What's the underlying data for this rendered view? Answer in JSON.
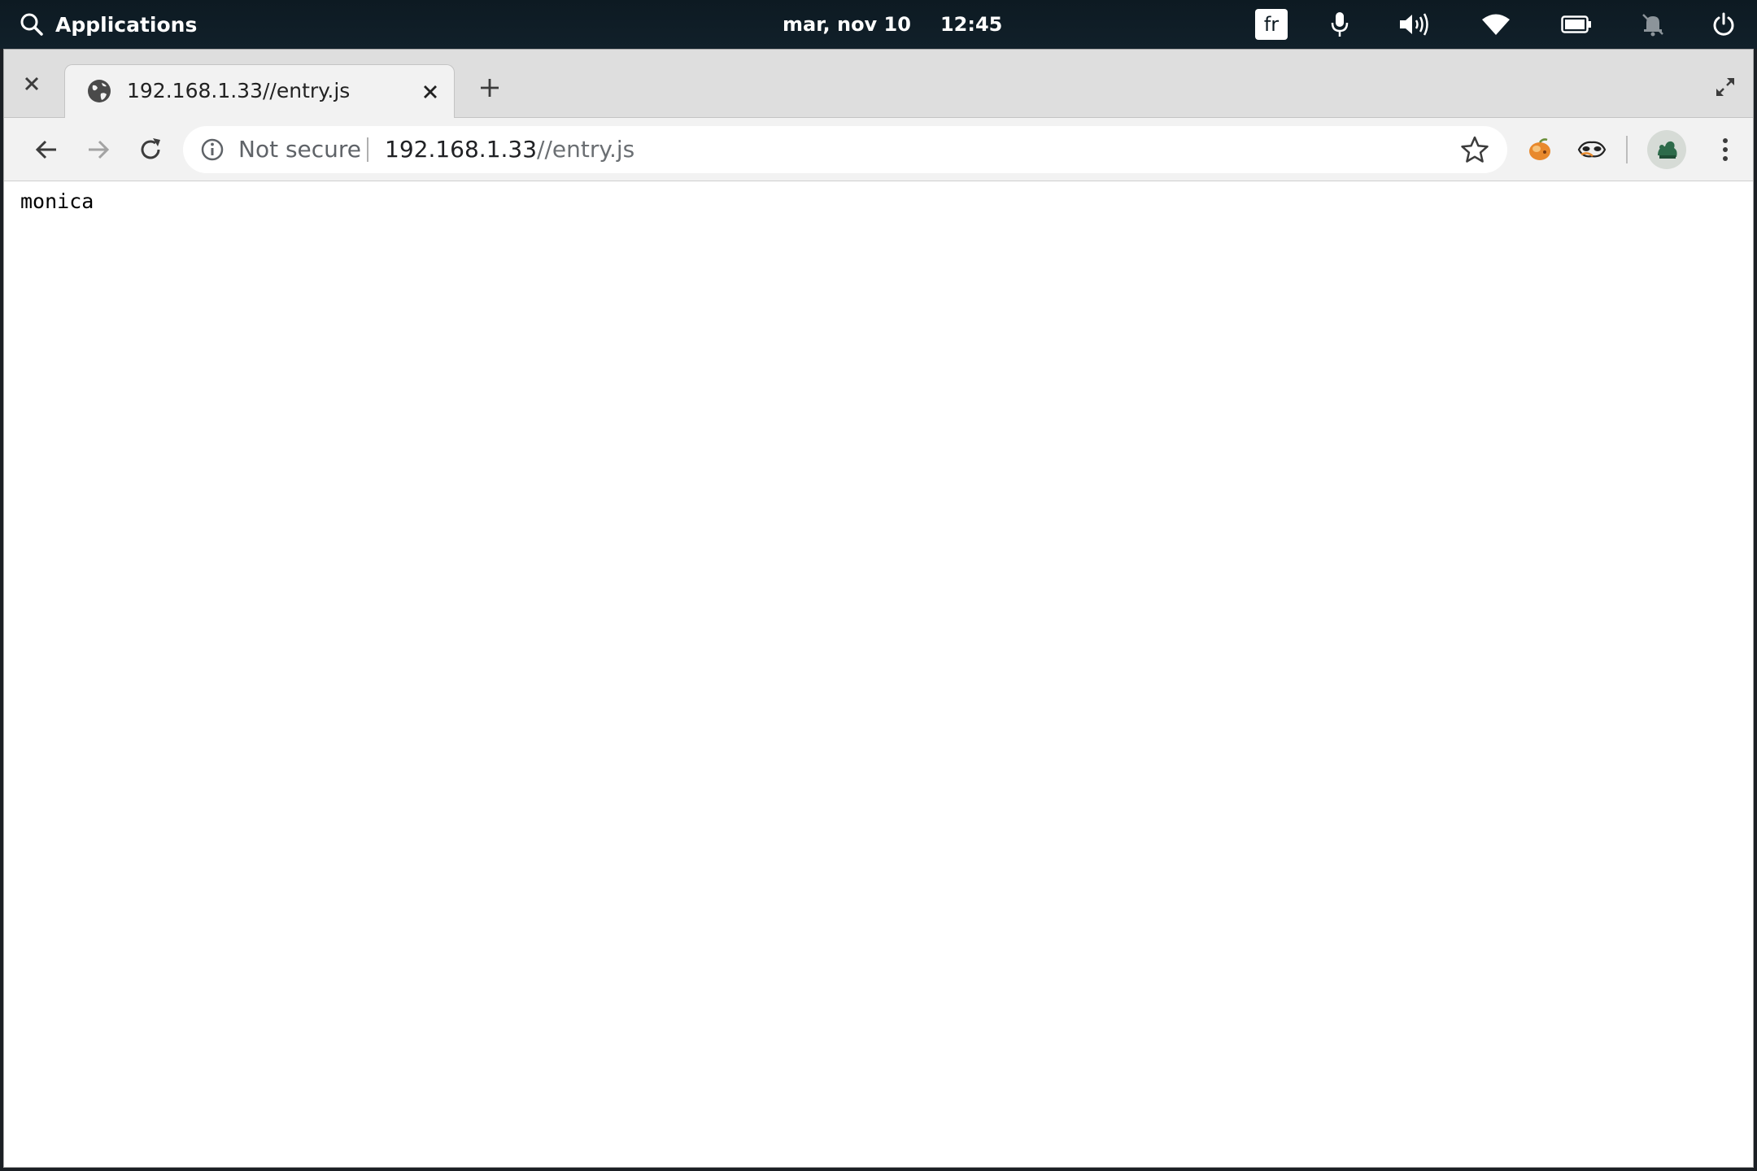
{
  "topbar": {
    "applications_label": "Applications",
    "date": "mar, nov 10",
    "time": "12:45",
    "keyboard_layout": "fr",
    "icons": [
      "search-icon",
      "microphone-icon",
      "volume-icon",
      "wifi-icon",
      "battery-icon",
      "notifications-muted-icon",
      "power-icon"
    ]
  },
  "browser": {
    "tab": {
      "title": "192.168.1.33//entry.js",
      "favicon": "globe-icon"
    },
    "omnibox": {
      "security_label": "Not secure",
      "url_host": "192.168.1.33",
      "url_path": "//entry.js"
    },
    "extensions": [
      "extension-orange-icon",
      "extension-mask-icon"
    ],
    "colors": {
      "topbar": "#0d1a22",
      "tabstrip": "#dedede",
      "toolbar": "#f2f2f2",
      "omnibox": "#ffffff"
    }
  },
  "page": {
    "text": "monica"
  }
}
